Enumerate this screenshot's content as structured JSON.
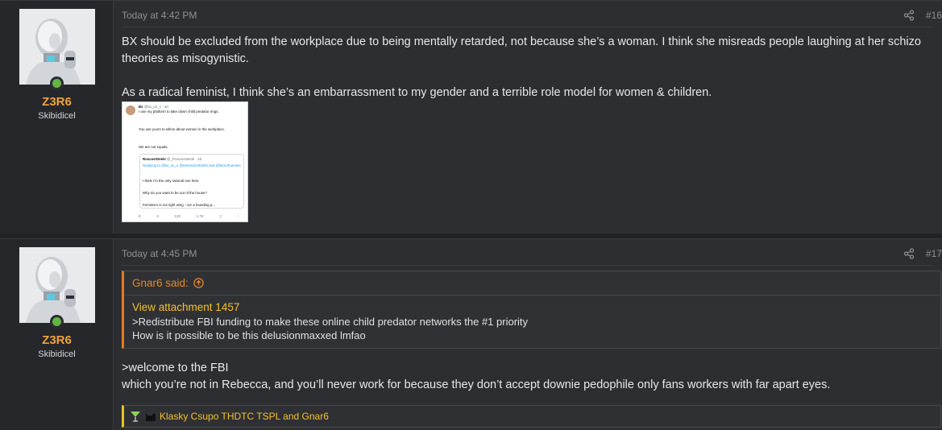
{
  "posts": [
    {
      "user": {
        "name": "Z3R6",
        "title": "Skibidicel"
      },
      "time": "Today at 4:42 PM",
      "number": "#16",
      "paragraphs": [
        "BX should be excluded from the workplace due to being mentally retarded, not because she’s a woman. I think she misreads people laughing at her schizo theories as misogynistic.",
        "As a radical feminist, I think she’s an embarrassment to my gender and a terrible role model for women & children."
      ],
      "attachment": {
        "author": "Bx",
        "handle": "@bx_on_x · 3d",
        "line1": "I use my platform to take down child predator rings.",
        "line2": "You use yours to whine about women in the workplace.",
        "line3": "We are not equals.",
        "quote_author": "RoscoeSteele",
        "quote_handle": "@_RoscoeSteele · 2d",
        "replying": "Replying to @bx_on_x @HarrisonHSmith and @NickJFuentes",
        "q1": "I think I’m the only rational one here",
        "q2": "Why do you want to be out of the house?",
        "q3": "Feminism is not right wing - nor a founding p...",
        "stats": [
          "9",
          "3",
          "123",
          "1.7K",
          "",
          ""
        ]
      }
    },
    {
      "user": {
        "name": "Z3R6",
        "title": "Skibidicel"
      },
      "time": "Today at 4:45 PM",
      "number": "#17",
      "quote": {
        "author_label": "Gnar6 said:",
        "link": "View attachment 1457",
        "lines": [
          ">Redistribute FBI funding to make these online child predator networks the #1 priority",
          "How is it possible to be this delusionmaxxed lmfao"
        ]
      },
      "lines": [
        ">welcome to the FBI",
        "which you’re not in Rebecca, and you’ll never work for because they don’t accept downie pedophile only fans workers with far apart eyes."
      ],
      "reactions": "Klasky Csupo THDTC TSPL and Gnar6"
    }
  ],
  "colors": {
    "accent": "#f0a33a",
    "quote": "#e07b20",
    "link": "#f3c12b",
    "online": "#63b543"
  }
}
